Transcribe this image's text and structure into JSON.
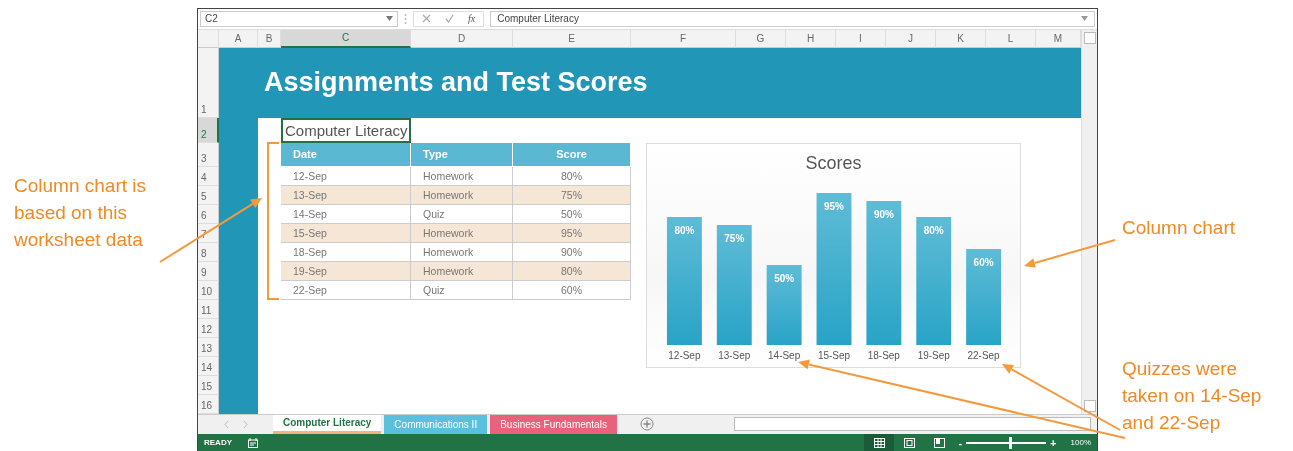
{
  "formula_bar": {
    "name_box": "C2",
    "function_label": "fx",
    "formula": "Computer Literacy"
  },
  "columns": [
    {
      "label": "A",
      "selected": false
    },
    {
      "label": "B",
      "selected": false
    },
    {
      "label": "C",
      "selected": true
    },
    {
      "label": "D",
      "selected": false
    },
    {
      "label": "E",
      "selected": false
    },
    {
      "label": "F",
      "selected": false
    },
    {
      "label": "G",
      "selected": false
    },
    {
      "label": "H",
      "selected": false
    },
    {
      "label": "I",
      "selected": false
    },
    {
      "label": "J",
      "selected": false
    },
    {
      "label": "K",
      "selected": false
    },
    {
      "label": "L",
      "selected": false
    },
    {
      "label": "M",
      "selected": false
    }
  ],
  "rows": [
    {
      "label": "1",
      "selected": false
    },
    {
      "label": "2",
      "selected": true
    },
    {
      "label": "3",
      "selected": false
    },
    {
      "label": "4",
      "selected": false
    },
    {
      "label": "5",
      "selected": false
    },
    {
      "label": "6",
      "selected": false
    },
    {
      "label": "7",
      "selected": false
    },
    {
      "label": "8",
      "selected": false
    },
    {
      "label": "9",
      "selected": false
    },
    {
      "label": "10",
      "selected": false
    },
    {
      "label": "11",
      "selected": false
    },
    {
      "label": "12",
      "selected": false
    },
    {
      "label": "13",
      "selected": false
    },
    {
      "label": "14",
      "selected": false
    },
    {
      "label": "15",
      "selected": false
    },
    {
      "label": "16",
      "selected": false
    }
  ],
  "banner": {
    "title": "Assignments and Test Scores"
  },
  "sheet_title": "Computer Literacy",
  "table": {
    "columns": [
      "Date",
      "Type",
      "Score"
    ],
    "rows": [
      [
        "12-Sep",
        "Homework",
        "80%"
      ],
      [
        "13-Sep",
        "Homework",
        "75%"
      ],
      [
        "14-Sep",
        "Quiz",
        "50%"
      ],
      [
        "15-Sep",
        "Homework",
        "95%"
      ],
      [
        "18-Sep",
        "Homework",
        "90%"
      ],
      [
        "19-Sep",
        "Homework",
        "80%"
      ],
      [
        "22-Sep",
        "Quiz",
        "60%"
      ]
    ]
  },
  "chart": {
    "chart_data": {
      "type": "bar",
      "title": "Scores",
      "categories": [
        "12-Sep",
        "13-Sep",
        "14-Sep",
        "15-Sep",
        "18-Sep",
        "19-Sep",
        "22-Sep"
      ],
      "values": [
        80,
        75,
        50,
        95,
        90,
        80,
        60
      ],
      "value_labels": [
        "80%",
        "75%",
        "50%",
        "95%",
        "90%",
        "80%",
        "60%"
      ]
    }
  },
  "sheet_tabs": [
    {
      "label": "Computer Literacy",
      "selected": true,
      "color": "#f4b183"
    },
    {
      "label": "Communications II",
      "selected": false,
      "color": "#5bc0de"
    },
    {
      "label": "Business Fundamentals",
      "selected": false,
      "color": "#e8627c"
    }
  ],
  "status_bar": {
    "mode": "READY",
    "views": [
      {
        "kind": "normal",
        "selected": true
      },
      {
        "kind": "page_layout",
        "selected": false
      },
      {
        "kind": "page_break",
        "selected": false
      }
    ],
    "zoom_minus": "-",
    "zoom": {
      "level": 0.55
    },
    "zoom_plus": "+",
    "zoom_reading": "100%"
  },
  "annotations": [
    {
      "text": "Column chart is based on this worksheet data"
    },
    {
      "text": "Column chart"
    },
    {
      "text": "Quizzes were taken on 14-Sep and 22-Sep"
    }
  ]
}
